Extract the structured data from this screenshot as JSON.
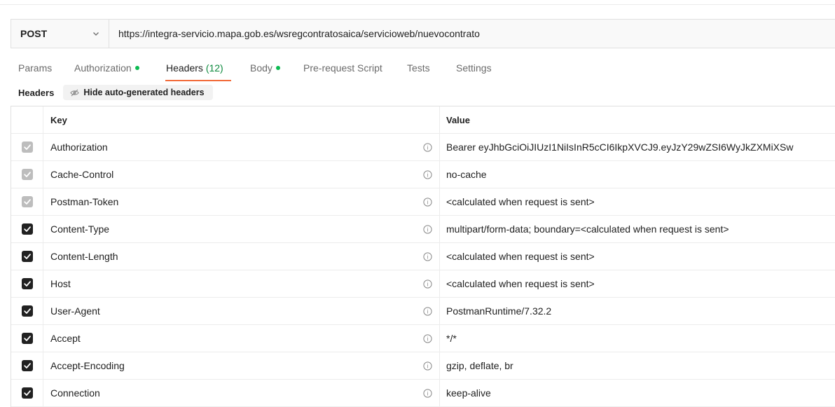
{
  "request": {
    "method": "POST",
    "url": "https://integra-servicio.mapa.gob.es/wsregcontratosaica/servicioweb/nuevocontrato"
  },
  "tabs": [
    {
      "label": "Params",
      "count": "",
      "dot": false,
      "active": false
    },
    {
      "label": "Authorization",
      "count": "",
      "dot": true,
      "active": false
    },
    {
      "label": "Headers ",
      "count": "(12)",
      "dot": false,
      "active": true
    },
    {
      "label": "Body",
      "count": "",
      "dot": true,
      "active": false
    },
    {
      "label": "Pre-request Script",
      "count": "",
      "dot": false,
      "active": false
    },
    {
      "label": "Tests",
      "count": "",
      "dot": false,
      "active": false
    },
    {
      "label": "Settings",
      "count": "",
      "dot": false,
      "active": false
    }
  ],
  "colors": {
    "accent": "#f26b3a",
    "status_dot": "#0cbb52",
    "count": "#0d8a3e"
  },
  "headers_section": {
    "label": "Headers",
    "hide_button": "Hide auto-generated headers",
    "columns": {
      "key": "Key",
      "value": "Value"
    },
    "rows": [
      {
        "key": "Authorization",
        "value": "Bearer eyJhbGciOiJIUzI1NiIsInR5cCI6IkpXVCJ9.eyJzY29wZSI6WyJkZXMiXSw",
        "state": "disabled"
      },
      {
        "key": "Cache-Control",
        "value": "no-cache",
        "state": "disabled"
      },
      {
        "key": "Postman-Token",
        "value": "<calculated when request is sent>",
        "state": "disabled"
      },
      {
        "key": "Content-Type",
        "value": "multipart/form-data; boundary=<calculated when request is sent>",
        "state": "checked"
      },
      {
        "key": "Content-Length",
        "value": "<calculated when request is sent>",
        "state": "checked"
      },
      {
        "key": "Host",
        "value": "<calculated when request is sent>",
        "state": "checked"
      },
      {
        "key": "User-Agent",
        "value": "PostmanRuntime/7.32.2",
        "state": "checked"
      },
      {
        "key": "Accept",
        "value": "*/*",
        "state": "checked"
      },
      {
        "key": "Accept-Encoding",
        "value": "gzip, deflate, br",
        "state": "checked"
      },
      {
        "key": "Connection",
        "value": "keep-alive",
        "state": "checked"
      }
    ]
  }
}
